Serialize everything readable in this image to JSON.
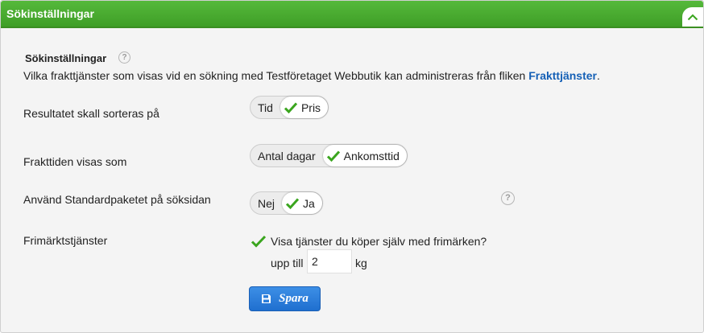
{
  "header": {
    "title": "Sökinställningar",
    "collapse_icon": "chevron-up-icon"
  },
  "section": {
    "title": "Sökinställningar",
    "help_icon": "question-circle-icon",
    "intro_text": "Vilka frakttjänster som visas vid en sökning med Testföretaget Webbutik kan administreras från fliken ",
    "intro_link": "Frakttjänster",
    "intro_end": "."
  },
  "settings": {
    "sort": {
      "label": "Resultatet skall sorteras på",
      "options": [
        "Tid",
        "Pris"
      ],
      "selected": "Pris"
    },
    "delivery": {
      "label": "Frakttiden visas som",
      "options": [
        "Antal dagar",
        "Ankomsttid"
      ],
      "selected": "Ankomsttid"
    },
    "standard": {
      "label": "Använd Standardpaketet på söksidan",
      "options": [
        "Nej",
        "Ja"
      ],
      "selected": "Ja"
    },
    "stamps": {
      "label": "Frimärktstjänster",
      "checkbox_label": "Visa tjänster du köper själv med frimärken?",
      "checked": true,
      "upto_label": "upp till",
      "weight_value": "2",
      "unit": "kg"
    }
  },
  "save_button": {
    "label": "Spara",
    "icon": "floppy-disk-icon"
  },
  "colors": {
    "header_green": "#4cae33",
    "check_green": "#3aa51e",
    "link_blue": "#1560b6",
    "button_blue": "#2a7ddb"
  }
}
